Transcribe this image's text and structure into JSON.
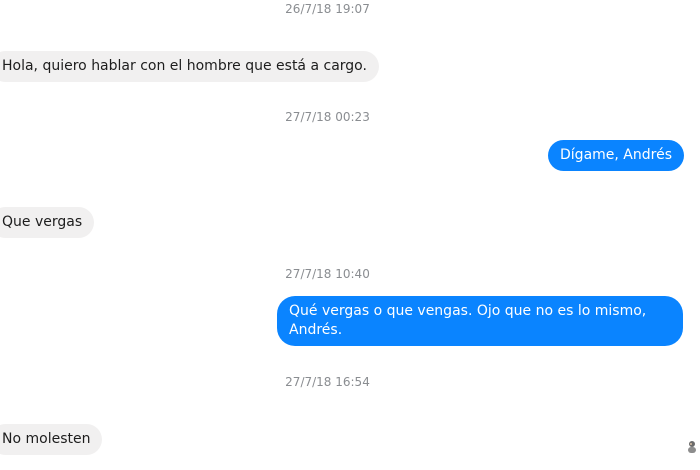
{
  "conversation": {
    "messages": [
      {
        "type": "timestamp",
        "text": "26/7/18 19:07"
      },
      {
        "type": "incoming",
        "text": "Hola, quiero hablar con el hombre que está a cargo."
      },
      {
        "type": "timestamp",
        "text": "27/7/18 00:23"
      },
      {
        "type": "outgoing",
        "text": "Dígame, Andrés"
      },
      {
        "type": "incoming",
        "text": "Que vergas"
      },
      {
        "type": "timestamp",
        "text": "27/7/18 10:40"
      },
      {
        "type": "outgoing",
        "text": "Qué vergas o que vengas. Ojo que no es lo mismo, Andrés."
      },
      {
        "type": "timestamp",
        "text": "27/7/18 16:54"
      },
      {
        "type": "incoming",
        "text": "No molesten"
      }
    ]
  },
  "colors": {
    "outgoing_bubble": "#0a84ff",
    "incoming_bubble": "#f1f0f0",
    "timestamp_text": "#8a8d91"
  },
  "icons": {
    "read_receipt": "sender-avatar-icon"
  }
}
